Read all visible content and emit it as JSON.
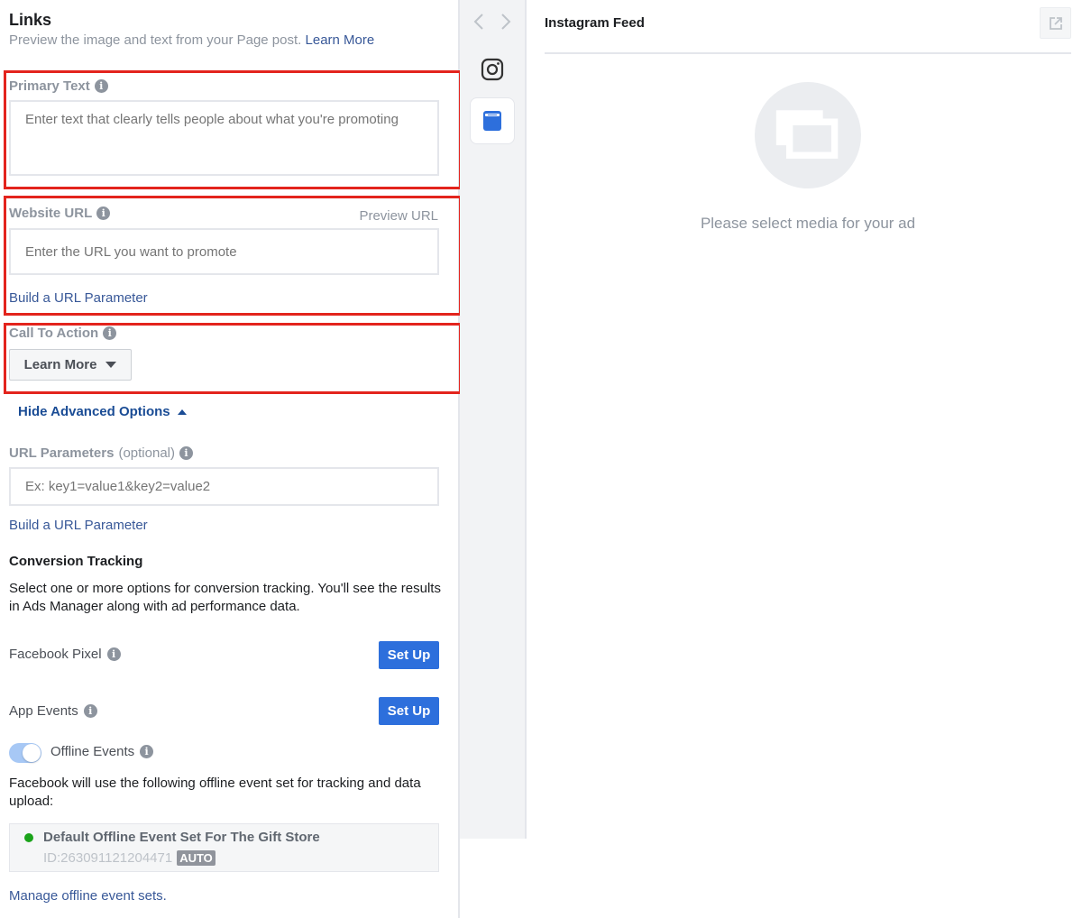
{
  "links": {
    "title": "Links",
    "subtitle": "Preview the image and text from your Page post.",
    "learn_more_link": "Learn More"
  },
  "primary_text": {
    "label": "Primary Text",
    "placeholder": "Enter text that clearly tells people about what you're promoting",
    "value": ""
  },
  "website_url": {
    "label": "Website URL",
    "preview_link": "Preview URL",
    "placeholder": "Enter the URL you want to promote",
    "value": "",
    "build_param_link": "Build a URL Parameter"
  },
  "call_to_action": {
    "label": "Call To Action",
    "selected": "Learn More"
  },
  "advanced": {
    "toggle_label": "Hide Advanced Options",
    "url_params": {
      "label": "URL Parameters",
      "optional": "(optional)",
      "placeholder": "Ex: key1=value1&key2=value2",
      "value": "",
      "build_param_link": "Build a URL Parameter"
    }
  },
  "conversion": {
    "title": "Conversion Tracking",
    "description": "Select one or more options for conversion tracking. You'll see the results in Ads Manager along with ad performance data.",
    "pixel": {
      "label": "Facebook Pixel",
      "button": "Set Up"
    },
    "app_events": {
      "label": "App Events",
      "button": "Set Up"
    },
    "offline": {
      "label": "Offline Events",
      "enabled": true,
      "description": "Facebook will use the following offline event set for tracking and data upload:",
      "event_set": {
        "name": "Default Offline Event Set For The Gift Store",
        "id": "ID:263091121204471",
        "badge": "AUTO",
        "status_color": "#1aa31a"
      },
      "manage_link": "Manage offline event sets."
    }
  },
  "preview": {
    "nav_icons": [
      "chevron-left-icon",
      "chevron-right-icon",
      "instagram-icon",
      "feed-icon"
    ],
    "placement_title": "Instagram Feed",
    "empty_message": "Please select media for your ad"
  },
  "colors": {
    "accent": "#2d6fdc",
    "link": "#385898",
    "highlight_box": "#e3241d"
  }
}
